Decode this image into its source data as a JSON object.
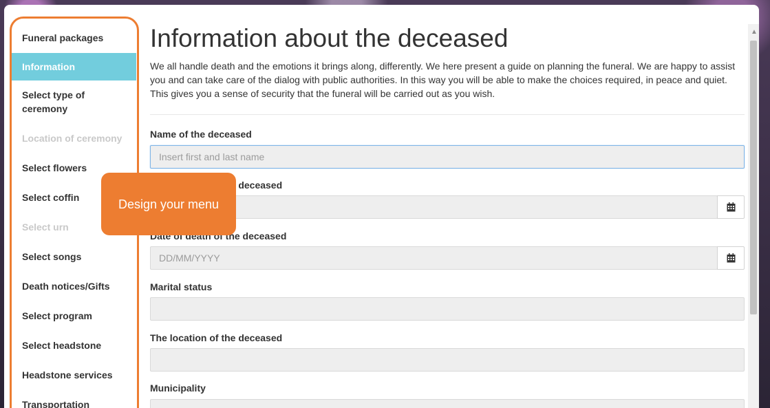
{
  "sidebar": {
    "items": [
      {
        "label": "Funeral packages",
        "state": "normal"
      },
      {
        "label": "Information",
        "state": "active"
      },
      {
        "label": "Select type of ceremony",
        "state": "normal"
      },
      {
        "label": "Location of ceremony",
        "state": "disabled"
      },
      {
        "label": "Select flowers",
        "state": "normal"
      },
      {
        "label": "Select coffin",
        "state": "normal"
      },
      {
        "label": "Select urn",
        "state": "disabled"
      },
      {
        "label": "Select songs",
        "state": "normal"
      },
      {
        "label": "Death notices/Gifts",
        "state": "normal"
      },
      {
        "label": "Select program",
        "state": "normal"
      },
      {
        "label": "Select headstone",
        "state": "normal"
      },
      {
        "label": "Headstone services",
        "state": "normal"
      },
      {
        "label": "Transportation",
        "state": "normal"
      }
    ]
  },
  "callout": {
    "text": "Design your menu"
  },
  "main": {
    "title": "Information about the deceased",
    "intro": "We all handle death and the emotions it brings along, differently. We here present a guide on planning the funeral. We are happy to assist you and can take care of the dialog with public authorities. In this way you will be able to make the choices required, in peace and quiet. This gives you a sense of security that the funeral will be carried out as you wish."
  },
  "form": {
    "name_label": "Name of the deceased",
    "name_placeholder": "Insert first and last name",
    "dob_label": "Date of birth of the deceased",
    "dob_placeholder": "DD/MM/YYYY",
    "dod_label": "Date of death of the deceased",
    "dod_placeholder": "DD/MM/YYYY",
    "marital_label": "Marital status",
    "location_label": "The location of the deceased",
    "municipality_label": "Municipality"
  },
  "colors": {
    "accent": "#ed7d31",
    "active": "#72cddd"
  },
  "icons": {
    "calendar": "calendar-icon"
  }
}
